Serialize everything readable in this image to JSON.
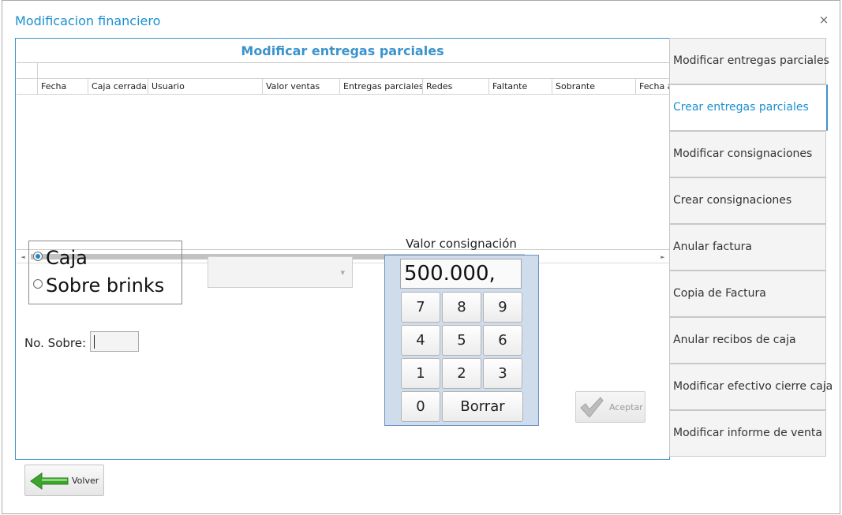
{
  "window": {
    "title": "Modificacion financiero",
    "close_glyph": "×"
  },
  "panel": {
    "title": "Modificar entregas parciales"
  },
  "grid": {
    "columns": [
      "Fecha",
      "Caja cerrada",
      "Usuario",
      "Valor ventas",
      "Entregas parciales",
      "Redes",
      "Faltante",
      "Sobrante",
      "Fecha a"
    ],
    "rows": []
  },
  "scroll": {
    "left_arrow": "◄",
    "right_arrow": "►"
  },
  "options": {
    "items": [
      {
        "label": "Caja",
        "selected": true
      },
      {
        "label": "Sobre brinks",
        "selected": false
      }
    ]
  },
  "combo": {
    "value": "",
    "arrow_glyph": "▼"
  },
  "sobre": {
    "label": "No. Sobre:",
    "value": ""
  },
  "keypad": {
    "label": "Valor consignación",
    "display": "500.000,",
    "keys": [
      "7",
      "8",
      "9",
      "4",
      "5",
      "6",
      "1",
      "2",
      "3",
      "0",
      "Borrar"
    ]
  },
  "buttons": {
    "aceptar": "Aceptar",
    "volver": "Volver"
  },
  "menu": {
    "items": [
      "Modificar entregas parciales",
      "Crear entregas parciales",
      "Modificar consignaciones",
      "Crear consignaciones",
      "Anular factura",
      "Copia de Factura",
      "Anular recibos de caja",
      "Modificar efectivo cierre caja",
      "Modificar informe de venta"
    ],
    "active_index": 1
  },
  "colors": {
    "accent": "#1a8fd1",
    "panel_border": "#3b93cc",
    "keypad_bg": "#cfdcec",
    "arrow_green": "#3aa62c"
  }
}
